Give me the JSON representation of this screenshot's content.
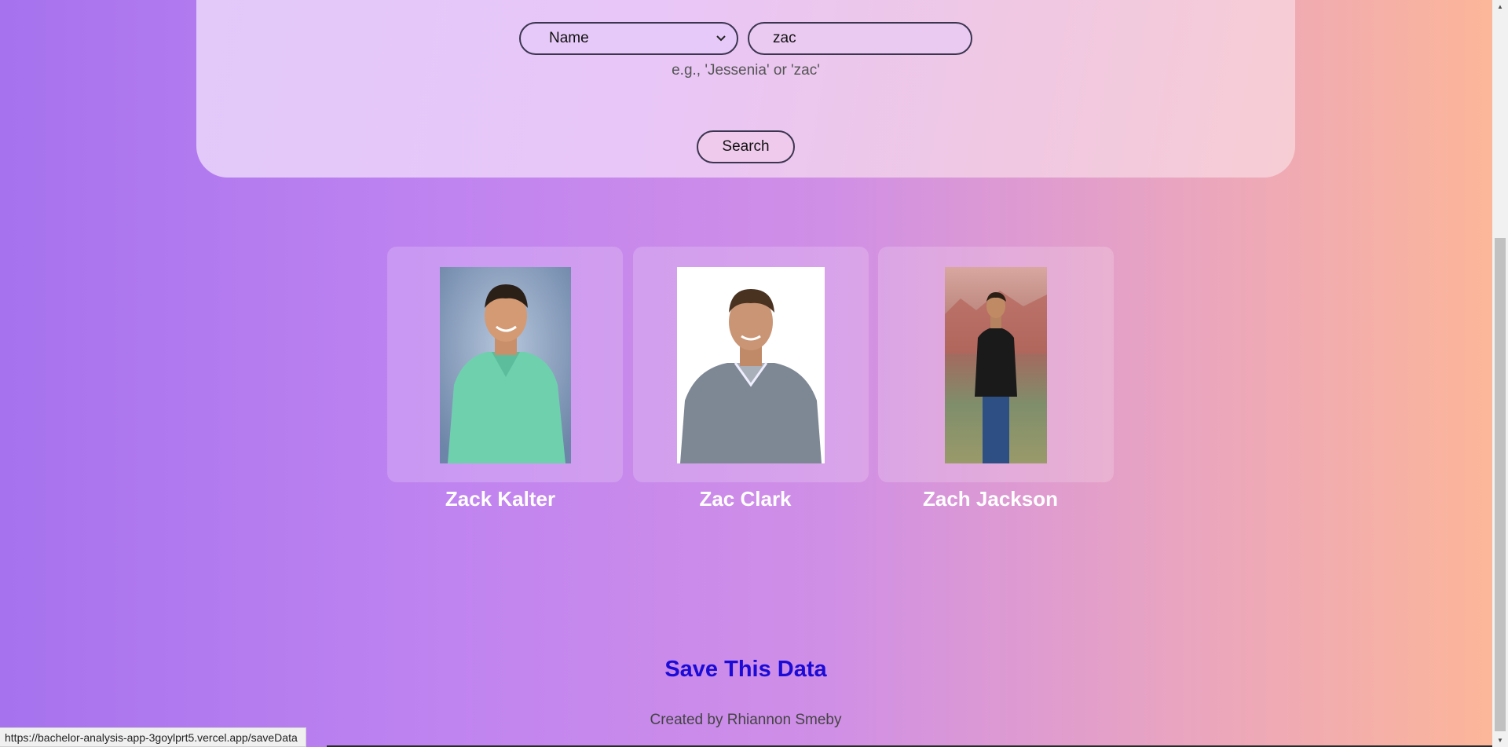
{
  "search_form": {
    "field_select_value": "Name",
    "query_value": "zac",
    "hint": "e.g., 'Jessenia' or 'zac'",
    "search_label": "Search"
  },
  "results": [
    {
      "name": "Zack Kalter",
      "photo_desc": "man in mint green shirt on blue backdrop"
    },
    {
      "name": "Zac Clark",
      "photo_desc": "man in grey polo on white backdrop"
    },
    {
      "name": "Zach Jackson",
      "photo_desc": "man in black t-shirt in desert canyon"
    }
  ],
  "footer": {
    "save_label": "Save This Data",
    "credit": "Created by Rhiannon Smeby"
  },
  "status_bar": {
    "url": "https://bachelor-analysis-app-3goylprt5.vercel.app/saveData"
  },
  "colors": {
    "link": "#1a0bd6",
    "gradient_left": "#a672ee",
    "gradient_right": "#fdb797"
  }
}
